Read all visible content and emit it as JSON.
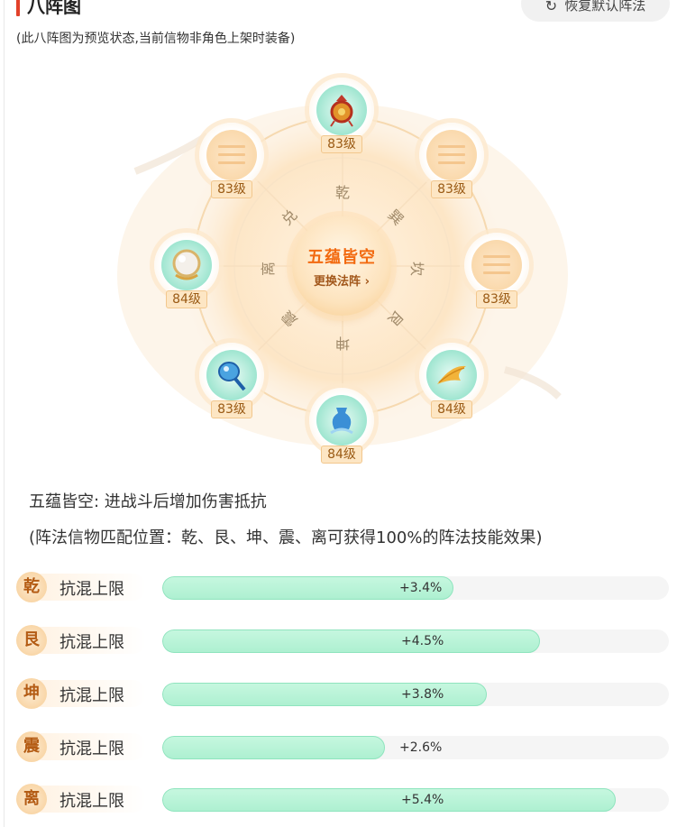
{
  "header": {
    "title": "八阵图",
    "subtitle": "(此八阵图为预览状态,当前信物非角色上架时装备)",
    "reset_label": "恢复默认阵法"
  },
  "formation": {
    "center_name": "五蕴皆空",
    "center_action": "更换法阵",
    "trigrams": [
      "乾",
      "巽",
      "坎",
      "艮",
      "坤",
      "震",
      "离",
      "兑"
    ],
    "slots": [
      {
        "level": "83级",
        "item": "red-knot-charm-icon"
      },
      {
        "level": "83级",
        "item": "empty-trigram-icon"
      },
      {
        "level": "83级",
        "item": "empty-trigram-icon"
      },
      {
        "level": "84级",
        "item": "golden-feather-icon"
      },
      {
        "level": "84级",
        "item": "blue-vase-icon"
      },
      {
        "level": "83级",
        "item": "blue-mirror-icon"
      },
      {
        "level": "84级",
        "item": "pearl-orb-icon"
      },
      {
        "level": "83级",
        "item": "empty-trigram-icon"
      }
    ]
  },
  "description": {
    "effect": "五蕴皆空: 进战斗后增加伤害抵抗",
    "note": "(阵法信物匹配位置：乾、艮、坤、震、离可获得100%的阵法技能效果)"
  },
  "stats": [
    {
      "position": "乾",
      "name": "抗混上限",
      "value": "+3.4%",
      "fill": 0.575
    },
    {
      "position": "艮",
      "name": "抗混上限",
      "value": "+4.5%",
      "fill": 0.745
    },
    {
      "position": "坤",
      "name": "抗混上限",
      "value": "+3.8%",
      "fill": 0.64
    },
    {
      "position": "震",
      "name": "抗混上限",
      "value": "+2.6%",
      "fill": 0.44
    },
    {
      "position": "离",
      "name": "抗混上限",
      "value": "+5.4%",
      "fill": 0.895
    }
  ],
  "colors": {
    "accent": "#f26a10",
    "title_bar": "#e2412a",
    "bar_fill": "#c6f7df",
    "bar_track": "#f5f5f5"
  }
}
